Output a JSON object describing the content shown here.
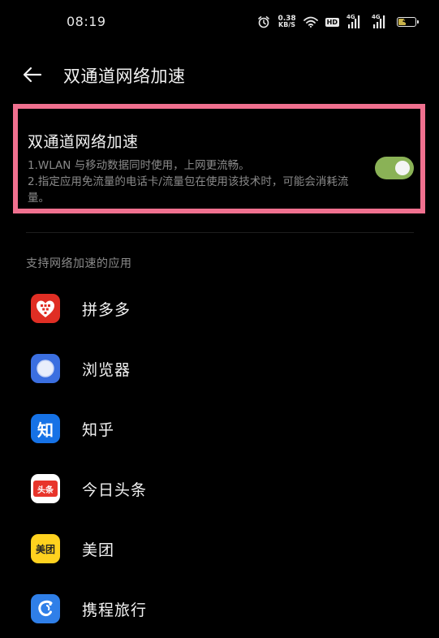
{
  "status_bar": {
    "time": "08:19",
    "net_speed_value": "0.38",
    "net_speed_unit": "KB/S",
    "hd_label": "HD",
    "sim1_label": "4G",
    "sim2_label": "4G",
    "battery_level": "48",
    "battery_fraction": 0.48
  },
  "header": {
    "title": "双通道网络加速"
  },
  "feature": {
    "title": "双通道网络加速",
    "desc_line1": "1.WLAN 与移动数据同时使用，上网更流畅。",
    "desc_line2": "2.指定应用免流量的电话卡/流量包在使用该技术时，可能会消耗流量。",
    "toggle_on": true
  },
  "section": {
    "label": "支持网络加速的应用"
  },
  "apps": [
    {
      "name": "拼多多",
      "icon": "pinduoduo-icon"
    },
    {
      "name": "浏览器",
      "icon": "browser-icon"
    },
    {
      "name": "知乎",
      "icon": "zhihu-icon",
      "icon_text": "知"
    },
    {
      "name": "今日头条",
      "icon": "toutiao-icon",
      "icon_text": "头条"
    },
    {
      "name": "美团",
      "icon": "meituan-icon",
      "icon_text": "美团"
    },
    {
      "name": "携程旅行",
      "icon": "ctrip-icon"
    }
  ],
  "colors": {
    "highlight_border": "#f0708f",
    "toggle_on": "#8ab256",
    "background": "#000000"
  }
}
